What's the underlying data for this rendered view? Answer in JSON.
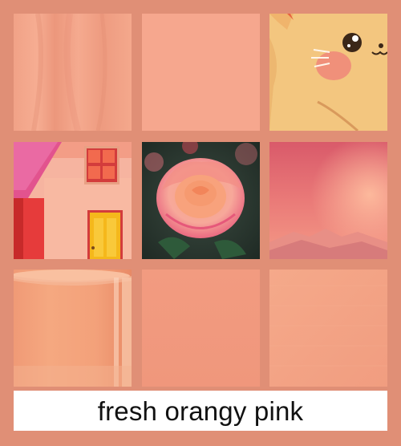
{
  "caption": {
    "text": "fresh orangy pink"
  },
  "colors": {
    "background": "#e08f76",
    "caption_background": "#ffffff",
    "caption_text": "#111111",
    "fabric": "#f2a286",
    "flat_swatch": "#f6a78e",
    "swatch_warm": "#f19c80",
    "swatch_smooth": "#f3a486",
    "rose_petal": "#f6a38f",
    "rose_edge": "#e6587a",
    "sky_top": "#d95a6a",
    "sky_bottom": "#f49a86",
    "cat_fur": "#f2c780",
    "house_wall": "#f7b7a0",
    "house_roof": "#e34f8f",
    "door_yellow": "#f5b81b"
  },
  "tiles": [
    {
      "subject": "draped fabric"
    },
    {
      "subject": "flat color swatch"
    },
    {
      "subject": "cartoon cat"
    },
    {
      "subject": "painted house"
    },
    {
      "subject": "rose flower"
    },
    {
      "subject": "pink sky over mountains"
    },
    {
      "subject": "glossy cup"
    },
    {
      "subject": "flat color swatch"
    },
    {
      "subject": "brushed color swatch"
    }
  ]
}
